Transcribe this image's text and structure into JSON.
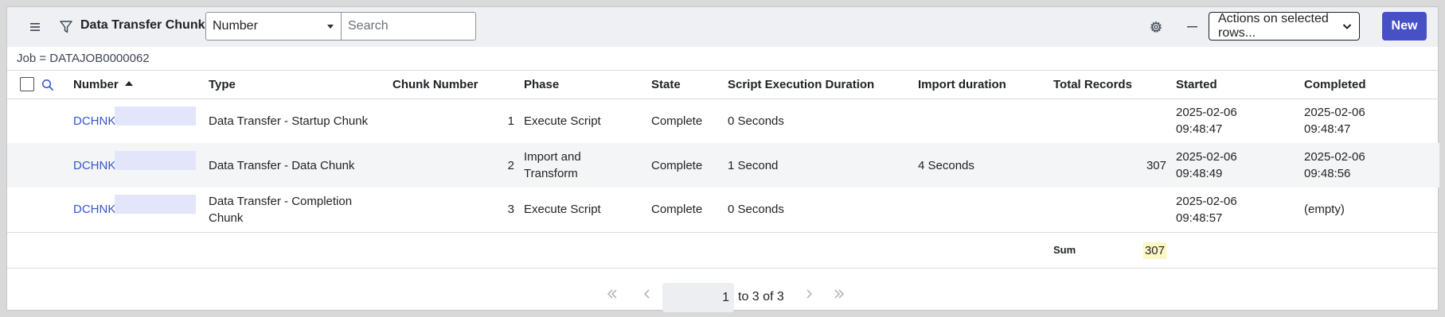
{
  "header": {
    "title": "Data Transfer Chunks",
    "field_select_value": "Number",
    "search_placeholder": "Search",
    "actions_label": "Actions on selected rows...",
    "new_label": "New",
    "accent_color": "#4750c4"
  },
  "breadcrumb": "Job = DATAJOB0000062",
  "columns": [
    "Number",
    "Type",
    "Chunk Number",
    "Phase",
    "State",
    "Script Execution Duration",
    "Import duration",
    "Total Records",
    "Started",
    "Completed"
  ],
  "rows": [
    {
      "number": "DCHNK",
      "type": "Data Transfer - Startup Chunk",
      "chunk_number": "1",
      "phase": "Execute Script",
      "state": "Complete",
      "script_duration": "0 Seconds",
      "import_duration": "",
      "total_records": "",
      "started": "2025-02-06 09:48:47",
      "completed": "2025-02-06 09:48:47"
    },
    {
      "number": "DCHNK",
      "type": "Data Transfer - Data Chunk",
      "chunk_number": "2",
      "phase": "Import and Transform",
      "state": "Complete",
      "script_duration": "1 Second",
      "import_duration": "4 Seconds",
      "total_records": "307",
      "started": "2025-02-06 09:48:49",
      "completed": "2025-02-06 09:48:56"
    },
    {
      "number": "DCHNK",
      "type": "Data Transfer - Completion Chunk",
      "chunk_number": "3",
      "phase": "Execute Script",
      "state": "Complete",
      "script_duration": "0 Seconds",
      "import_duration": "",
      "total_records": "",
      "started": "2025-02-06 09:48:57",
      "completed": "(empty)"
    }
  ],
  "summary": {
    "label": "Sum",
    "value": "307"
  },
  "pagination": {
    "current_page": "1",
    "range_text": "to 3 of 3"
  },
  "icons": [
    "menu-icon",
    "filter-icon",
    "gear-icon",
    "minus-icon",
    "search-icon",
    "first-page-icon",
    "prev-page-icon",
    "next-page-icon",
    "last-page-icon"
  ]
}
